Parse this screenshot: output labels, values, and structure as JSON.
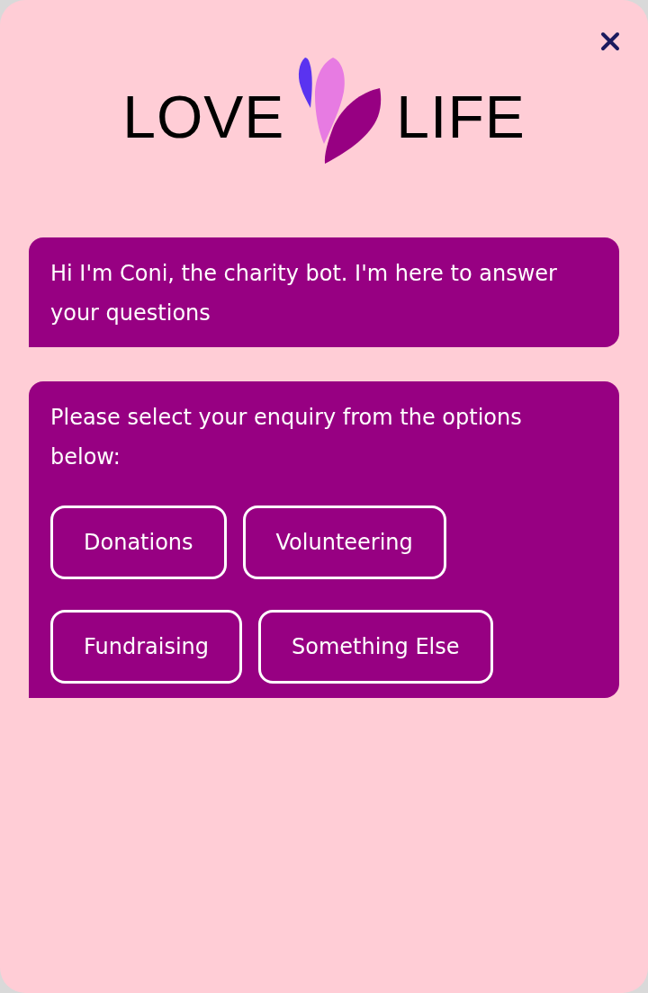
{
  "logo": {
    "left_word": "LOVE",
    "right_word": "LIFE"
  },
  "messages": [
    {
      "text": "Hi I'm Coni, the charity bot. I'm here to answer your questions"
    },
    {
      "text": "Please select your enquiry from the options below:",
      "options": [
        "Donations",
        "Volunteering",
        "Fundraising",
        "Something Else"
      ]
    }
  ]
}
